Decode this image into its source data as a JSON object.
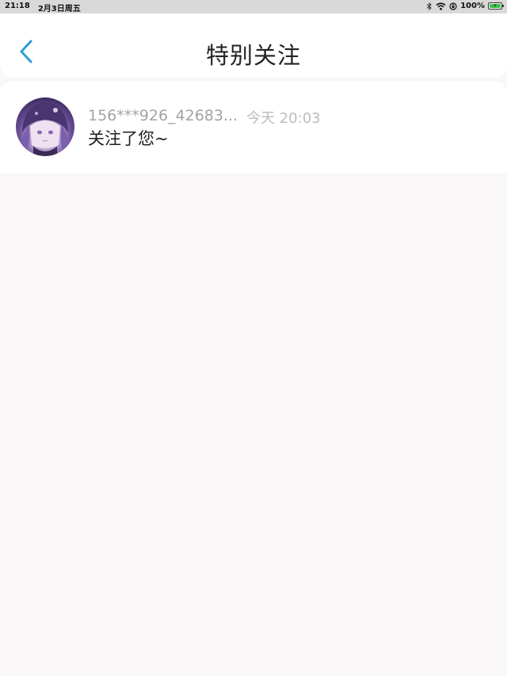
{
  "status_bar": {
    "time": "21:18",
    "date": "2月3日周五",
    "battery_percent": "100%",
    "battery_level": 1.0,
    "icons": [
      "bluetooth-icon",
      "wifi-icon",
      "orientation-lock-icon",
      "battery-icon",
      "charging-icon"
    ]
  },
  "header": {
    "back_icon": "chevron-left-icon",
    "title": "特别关注"
  },
  "list": [
    {
      "avatar_icon": "avatar-icon",
      "username": "156***926_42683...",
      "time": "今天 20:03",
      "message": "关注了您~"
    }
  ],
  "colors": {
    "accent": "#2d9cdb",
    "background": "#f9f7f8",
    "card": "#ffffff",
    "status_bar": "#d9d9d9"
  }
}
